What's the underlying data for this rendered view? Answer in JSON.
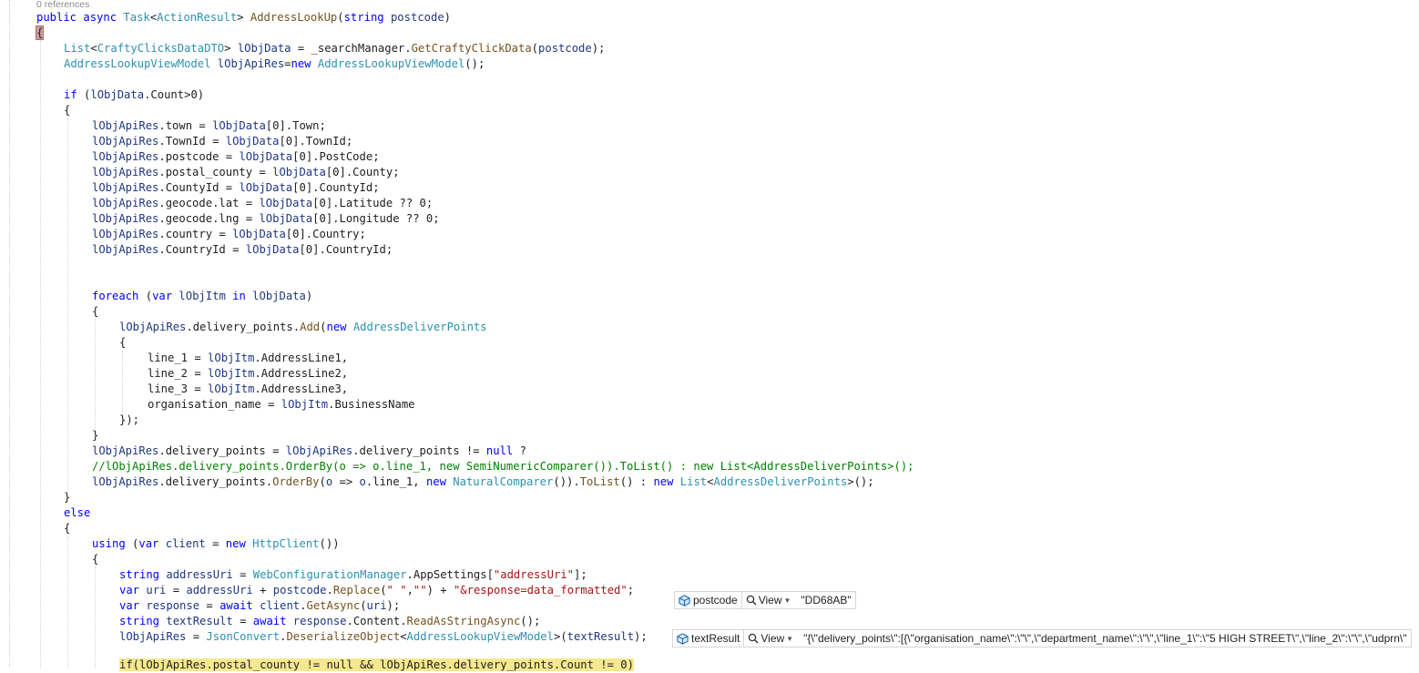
{
  "codelens": "0 references",
  "tooltips": {
    "postcode": {
      "name": "postcode",
      "view_label": "View",
      "value": "\"DD68AB\""
    },
    "textResult": {
      "name": "textResult",
      "view_label": "View",
      "value": "\"{\\\"delivery_points\\\":[{\\\"organisation_name\\\":\\\"\\\",\\\"department_name\\\":\\\"\\\",\\\"line_1\\\":\\\"5 HIGH STREET\\\",\\\"line_2\\\":\\\"\\\",\\\"udprn\\\""
    }
  },
  "code": {
    "sig": {
      "public": "public",
      "async": "async",
      "task": "Task",
      "lt": "<",
      "action": "ActionResult",
      "gt": ">",
      "method": "AddressLookUp",
      "open": "(",
      "string": "string",
      "param": "postcode",
      "close": ")"
    },
    "brace_open": "{",
    "l3": [
      "List",
      "<",
      "CraftyClicksDataDTO",
      "> ",
      "lObjData",
      " = _searchManager.",
      "GetCraftyClickData",
      "(",
      "postcode",
      ");"
    ],
    "l4": [
      "AddressLookupViewModel",
      " ",
      "lObjApiRes",
      "=",
      "new",
      " ",
      "AddressLookupViewModel",
      "();"
    ],
    "l6": [
      "if",
      " (",
      "lObjData",
      ".Count>0)"
    ],
    "l7": "{",
    "assign": [
      [
        "lObjApiRes",
        ".town = ",
        "lObjData",
        "[0].Town;"
      ],
      [
        "lObjApiRes",
        ".TownId = ",
        "lObjData",
        "[0].TownId;"
      ],
      [
        "lObjApiRes",
        ".postcode = ",
        "lObjData",
        "[0].PostCode;"
      ],
      [
        "lObjApiRes",
        ".postal_county = ",
        "lObjData",
        "[0].County;"
      ],
      [
        "lObjApiRes",
        ".CountyId = ",
        "lObjData",
        "[0].CountyId;"
      ],
      [
        "lObjApiRes",
        ".geocode.lat = ",
        "lObjData",
        "[0].Latitude ?? 0;"
      ],
      [
        "lObjApiRes",
        ".geocode.lng = ",
        "lObjData",
        "[0].Longitude ?? 0;"
      ],
      [
        "lObjApiRes",
        ".country = ",
        "lObjData",
        "[0].Country;"
      ],
      [
        "lObjApiRes",
        ".CountryId = ",
        "lObjData",
        "[0].CountryId;"
      ]
    ],
    "foreach": [
      "foreach",
      " (",
      "var",
      " ",
      "lObjItm",
      " ",
      "in",
      " ",
      "lObjData",
      ")"
    ],
    "fe_open": "{",
    "add": [
      "lObjApiRes",
      ".delivery_points.",
      "Add",
      "(",
      "new",
      " ",
      "AddressDeliverPoints"
    ],
    "init_open": "{",
    "init": [
      [
        "line_1 = ",
        "lObjItm",
        ".AddressLine1,"
      ],
      [
        "line_2 = ",
        "lObjItm",
        ".AddressLine2,"
      ],
      [
        "line_3 = ",
        "lObjItm",
        ".AddressLine3,"
      ],
      [
        "organisation_name = ",
        "lObjItm",
        ".BusinessName"
      ]
    ],
    "init_close": "});",
    "fe_close": "}",
    "dp1": [
      "lObjApiRes",
      ".delivery_points = ",
      "lObjApiRes",
      ".delivery_points != ",
      "null",
      " ?"
    ],
    "comment": "//lObjApiRes.delivery_points.OrderBy(o => o.line_1, new SemiNumericComparer()).ToList() : new List<AddressDeliverPoints>();",
    "dp2": [
      "lObjApiRes",
      ".delivery_points.",
      "OrderBy",
      "(",
      "o",
      " => ",
      "o",
      ".line_1, ",
      "new",
      " ",
      "NaturalComparer",
      "()).",
      "ToList",
      "() : ",
      "new",
      " ",
      "List",
      "<",
      "AddressDeliverPoints",
      ">();"
    ],
    "if_close": "}",
    "else": "else",
    "else_open": "{",
    "using": [
      "using",
      " (",
      "var",
      " ",
      "client",
      " = ",
      "new",
      " ",
      "HttpClient",
      "())"
    ],
    "using_open": "{",
    "u1": [
      "string",
      " ",
      "addressUri",
      " = ",
      "WebConfigurationManager",
      ".AppSettings[",
      "\"addressUri\"",
      "];"
    ],
    "u2": [
      "var",
      " ",
      "uri",
      " = ",
      "addressUri",
      " + ",
      "postcode",
      ".",
      "Replace",
      "(",
      "\" \"",
      ",",
      "\"\"",
      ") + ",
      "\"&response=data_formatted\"",
      ";"
    ],
    "u3": [
      "var",
      " ",
      "response",
      " = ",
      "await",
      " ",
      "client",
      ".",
      "GetAsync",
      "(",
      "uri",
      ");"
    ],
    "u4": [
      "string",
      " ",
      "textResult",
      " = ",
      "await",
      " ",
      "response",
      ".Content.",
      "ReadAsStringAsync",
      "();"
    ],
    "u5": [
      "lObjApiRes",
      " = ",
      "JsonConvert",
      ".",
      "DeserializeObject",
      "<",
      "AddressLookupViewModel",
      ">(",
      "textResult",
      ");"
    ],
    "u6": "if(lObjApiRes.postal_county != null && lObjApiRes.delivery_points.Count != 0)"
  }
}
